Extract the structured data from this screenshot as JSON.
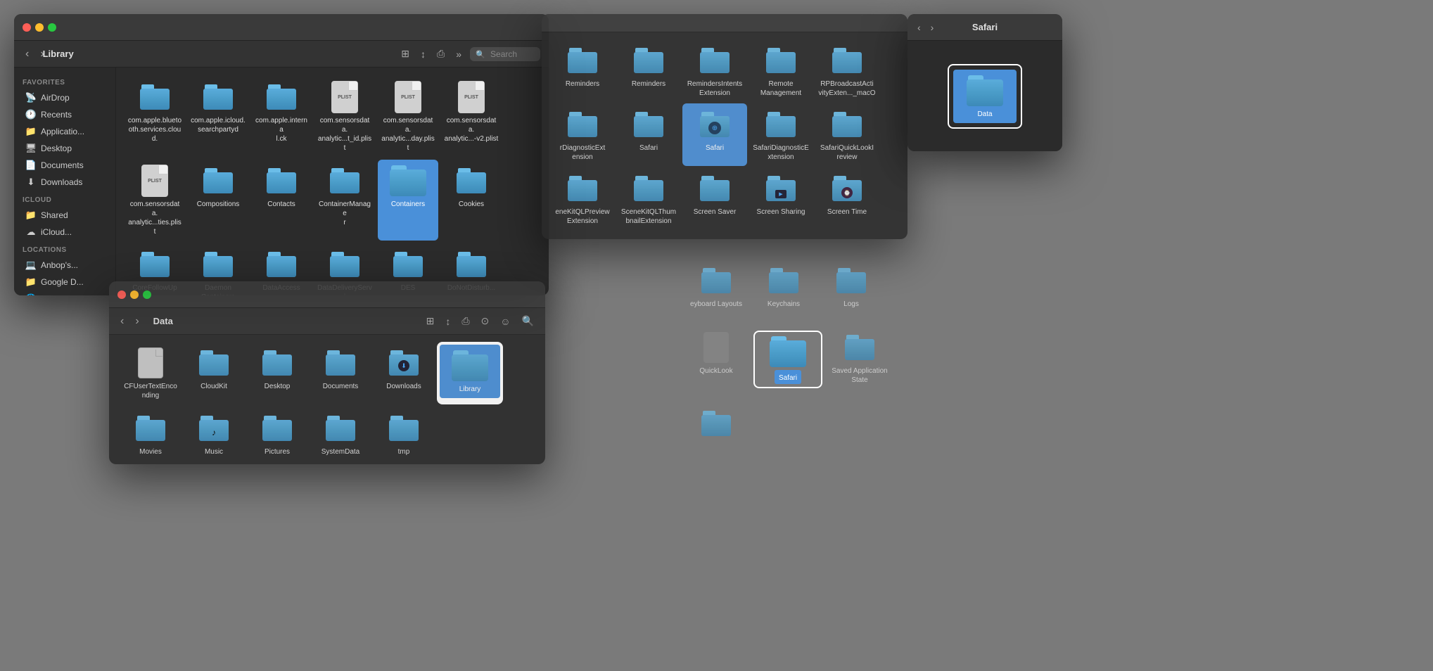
{
  "windows": {
    "library": {
      "title": "Library",
      "toolbar": {
        "back_label": "‹",
        "forward_label": "›",
        "search_placeholder": "Search"
      },
      "sidebar": {
        "favorites_label": "Favorites",
        "items": [
          {
            "label": "AirDrop",
            "icon": "📡"
          },
          {
            "label": "Recents",
            "icon": "🕐"
          },
          {
            "label": "Applicatio...",
            "icon": "📁"
          },
          {
            "label": "Desktop",
            "icon": "🖥"
          },
          {
            "label": "Documents",
            "icon": "📄"
          },
          {
            "label": "Downloads",
            "icon": "⬇"
          }
        ],
        "icloud_label": "iCloud",
        "icloud_items": [
          {
            "label": "Shared",
            "icon": "📁"
          },
          {
            "label": "iCloud...",
            "icon": "☁"
          }
        ],
        "locations_label": "Locations",
        "locations_items": [
          {
            "label": "Anbop's...",
            "icon": "💻"
          },
          {
            "label": "Google D...",
            "icon": "📁"
          },
          {
            "label": "Network",
            "icon": "🌐"
          }
        ]
      },
      "files": [
        {
          "name": "com.apple.blueto\nth.services.cloud.",
          "type": "folder"
        },
        {
          "name": "com.apple.icloud.\nsearchpartyd",
          "type": "folder"
        },
        {
          "name": "com.apple.interna\nl.ck",
          "type": "folder"
        },
        {
          "name": "com.sensorsdata.\nanalytic...t_id.plist",
          "type": "plist"
        },
        {
          "name": "com.sensorsdata.\nanalytic...day.plist",
          "type": "plist"
        },
        {
          "name": "com.sensorsdata.\nanalytic...-v2.plist",
          "type": "plist"
        },
        {
          "name": "com.sensorsdata.\nanalytic...ties.plist",
          "type": "plist"
        },
        {
          "name": "Compositions",
          "type": "folder"
        },
        {
          "name": "Contacts",
          "type": "folder"
        },
        {
          "name": "ContainerManage\nr",
          "type": "folder"
        },
        {
          "name": "Containers",
          "type": "folder",
          "selected": true
        },
        {
          "name": "Cookies",
          "type": "folder"
        },
        {
          "name": "CoreFollowUp",
          "type": "folder"
        },
        {
          "name": "Daemon\nContainers",
          "type": "folder"
        },
        {
          "name": "DataAccess",
          "type": "folder"
        },
        {
          "name": "DataDeliveryServi\nces",
          "type": "folder"
        },
        {
          "name": "DES",
          "type": "folder"
        },
        {
          "name": "DoNotDisturb...",
          "type": "folder"
        },
        {
          "name": "",
          "type": "folder"
        },
        {
          "name": "",
          "type": "folder"
        },
        {
          "name": "",
          "type": "folder"
        },
        {
          "name": "",
          "type": "folder"
        },
        {
          "name": "",
          "type": "folder"
        },
        {
          "name": "",
          "type": "folder"
        }
      ]
    },
    "data": {
      "title": "Data",
      "files": [
        {
          "name": "CFUserTextEnco\nnding",
          "type": "plist_small"
        },
        {
          "name": "CloudKit",
          "type": "folder"
        },
        {
          "name": "Desktop",
          "type": "folder"
        },
        {
          "name": "Documents",
          "type": "folder"
        },
        {
          "name": "Downloads",
          "type": "folder"
        },
        {
          "name": "Library",
          "type": "folder",
          "selected": true
        },
        {
          "name": "Movies",
          "type": "folder"
        },
        {
          "name": "Music",
          "type": "folder"
        },
        {
          "name": "Pictures",
          "type": "folder"
        },
        {
          "name": "SystemData",
          "type": "folder"
        },
        {
          "name": "tmp",
          "type": "folder"
        }
      ]
    },
    "safari_nav": {
      "title": "Safari",
      "files": [
        {
          "name": "Data",
          "type": "folder",
          "selected": true
        }
      ]
    },
    "right_panel": {
      "files_row1": [
        {
          "name": "Reminders",
          "type": "folder"
        },
        {
          "name": "Reminders",
          "type": "folder"
        },
        {
          "name": "RemindersIntents\nExtension",
          "type": "folder"
        },
        {
          "name": "Remote\nManagement",
          "type": "folder"
        },
        {
          "name": "RPBroadcastActi\nvityExten..._macO",
          "type": "folder"
        }
      ],
      "files_row2": [
        {
          "name": "rDiagnosticExt\nension",
          "type": "folder"
        },
        {
          "name": "Safari",
          "type": "folder"
        },
        {
          "name": "Safari",
          "type": "folder",
          "selected": true,
          "has_globe": true
        },
        {
          "name": "SafariDiagnosticE\nxtension",
          "type": "folder"
        },
        {
          "name": "SafariQuickLookI\nreview",
          "type": "folder"
        }
      ],
      "files_row3": [
        {
          "name": "eneKitQLPreview\nExtension",
          "type": "folder"
        },
        {
          "name": "SceneKitQLThum\nbnailExtension",
          "type": "folder"
        },
        {
          "name": "Screen Saver",
          "type": "folder"
        },
        {
          "name": "Screen Sharing",
          "type": "folder"
        },
        {
          "name": "Screen Time",
          "type": "folder"
        }
      ]
    }
  },
  "background_folders_top": [
    {
      "name": "eyboard Layouts",
      "type": "folder"
    },
    {
      "name": "Keychains",
      "type": "folder"
    },
    {
      "name": "Logs",
      "type": "folder"
    },
    {
      "name": "QuickLook",
      "type": "folder_small"
    },
    {
      "name": "Safari",
      "type": "folder",
      "selected": true
    },
    {
      "name": "Saved Application\nState",
      "type": "folder"
    },
    {
      "name": "",
      "type": "folder"
    }
  ],
  "colors": {
    "window_bg": "#2b2b2b",
    "titlebar_bg": "#3a3a3a",
    "sidebar_bg": "#2a2a2a",
    "folder_main": "#4a9cc8",
    "selected_blue": "#4a90d9",
    "body_bg": "#7a7a7a"
  }
}
